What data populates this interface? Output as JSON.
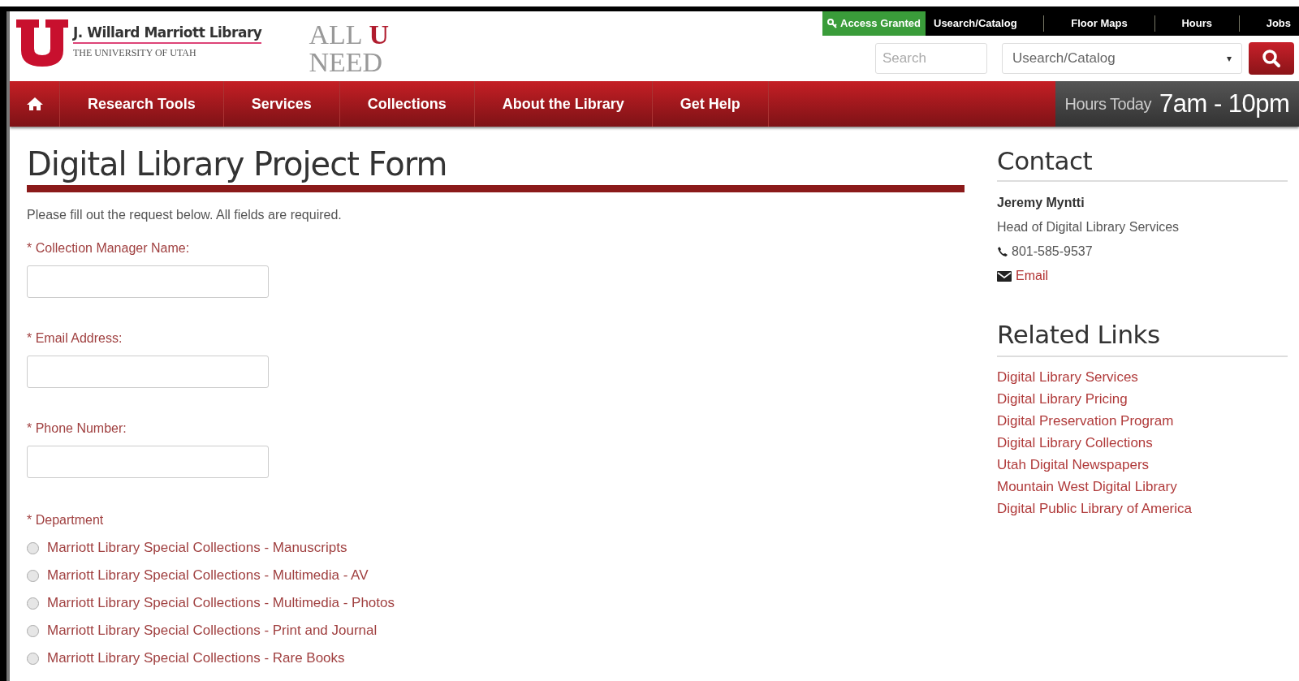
{
  "header": {
    "logo": {
      "title": "J. Willard Marriott Library",
      "subtitle": "THE UNIVERSITY OF UTAH"
    },
    "tagline": {
      "word_1": "ALL",
      "word_2": "U",
      "word_3": "NEED"
    },
    "access_badge": "Access Granted",
    "top_links": [
      "Usearch/Catalog",
      "Floor Maps",
      "Hours",
      "Jobs"
    ],
    "search": {
      "placeholder": "Search"
    },
    "scope_select": {
      "value": "Usearch/Catalog",
      "caret": "▾"
    }
  },
  "nav": {
    "items": [
      {
        "label": "Research Tools"
      },
      {
        "label": "Services"
      },
      {
        "label": "Collections"
      },
      {
        "label": "About the Library"
      },
      {
        "label": "Get Help"
      }
    ],
    "hours": {
      "label": "Hours Today",
      "value": "7am - 10pm"
    }
  },
  "form": {
    "title": "Digital Library Project Form",
    "intro": "Please fill out the request below. All fields are required.",
    "fields": [
      {
        "label": "* Collection Manager Name:"
      },
      {
        "label": "* Email Address:"
      },
      {
        "label": "* Phone Number:"
      }
    ],
    "department": {
      "label": "* Department",
      "options": [
        {
          "label": "Marriott Library Special Collections - Manuscripts",
          "selected": false
        },
        {
          "label": "Marriott Library Special Collections - Multimedia - AV",
          "selected": false
        },
        {
          "label": "Marriott Library Special Collections - Multimedia - Photos",
          "selected": false
        },
        {
          "label": "Marriott Library Special Collections - Print and Journal",
          "selected": false
        },
        {
          "label": "Marriott Library Special Collections - Rare Books",
          "selected": false
        }
      ]
    }
  },
  "sidebar": {
    "contact": {
      "heading": "Contact",
      "name": "Jeremy Myntti",
      "role": "Head of Digital Library Services",
      "phone": "801-585-9537",
      "email": "Email"
    },
    "related": {
      "heading": "Related Links",
      "links": [
        "Digital Library Services",
        "Digital Library Pricing",
        "Digital Preservation Program",
        "Digital Library Collections",
        "Utah Digital Newspapers",
        "Mountain West Digital Library",
        "Digital Public Library of America"
      ]
    }
  }
}
